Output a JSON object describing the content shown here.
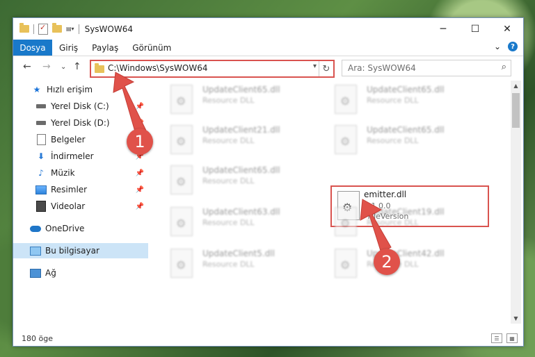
{
  "window": {
    "title": "SysWOW64",
    "controls": {
      "minimize": "─",
      "maximize": "☐",
      "close": "✕"
    }
  },
  "ribbon": {
    "tabs": [
      "Dosya",
      "Giriş",
      "Paylaş",
      "Görünüm"
    ],
    "help": "?",
    "expand": "⌄"
  },
  "nav": {
    "back": "←",
    "forward": "→",
    "recent": "⌄",
    "up": "↑",
    "address": "C:\\Windows\\SysWOW64",
    "search_placeholder": "Ara: SysWOW64"
  },
  "sidebar": {
    "items": [
      {
        "label": "Hızlı erişim",
        "icon": "star-icon"
      },
      {
        "label": "Yerel Disk (C:)",
        "icon": "disk-icon",
        "pinned": true
      },
      {
        "label": "Yerel Disk (D:)",
        "icon": "disk-icon",
        "pinned": true
      },
      {
        "label": "Belgeler",
        "icon": "document-icon",
        "pinned": true
      },
      {
        "label": "İndirmeler",
        "icon": "download-icon",
        "pinned": true
      },
      {
        "label": "Müzik",
        "icon": "music-icon",
        "pinned": true
      },
      {
        "label": "Resimler",
        "icon": "pictures-icon",
        "pinned": true
      },
      {
        "label": "Videolar",
        "icon": "videos-icon",
        "pinned": true
      },
      {
        "label": "OneDrive",
        "icon": "onedrive-icon"
      },
      {
        "label": "Bu bilgisayar",
        "icon": "computer-icon",
        "selected": true
      },
      {
        "label": "Ağ",
        "icon": "network-icon"
      }
    ]
  },
  "files": [
    {
      "name": "UpdateClient65.dll",
      "desc": "Resource DLL"
    },
    {
      "name": "UpdateClient65.dll",
      "desc": "Resource DLL"
    },
    {
      "name": "UpdateClient21.dll",
      "desc": "Resource DLL"
    },
    {
      "name": "UpdateClient65.dll",
      "desc": "Resource DLL"
    },
    {
      "name": "UpdateClient65.dll",
      "desc": "Resource DLL"
    },
    {
      "name": "UpdateClient63.dll",
      "desc": "Resource DLL"
    },
    {
      "name": "UpdateClient19.dll",
      "desc": "Resource DLL"
    },
    {
      "name": "UpdateClient5.dll",
      "desc": "Resource DLL"
    },
    {
      "name": "UpdateClient42.dll",
      "desc": "Resource DLL"
    }
  ],
  "highlighted_file": {
    "name": "emitter.dll",
    "version": "1.1.0.0",
    "meta": "*FileVersion"
  },
  "status": {
    "count": "180 öge"
  },
  "annotations": {
    "badge1": "1",
    "badge2": "2",
    "color": "#e0524a"
  }
}
